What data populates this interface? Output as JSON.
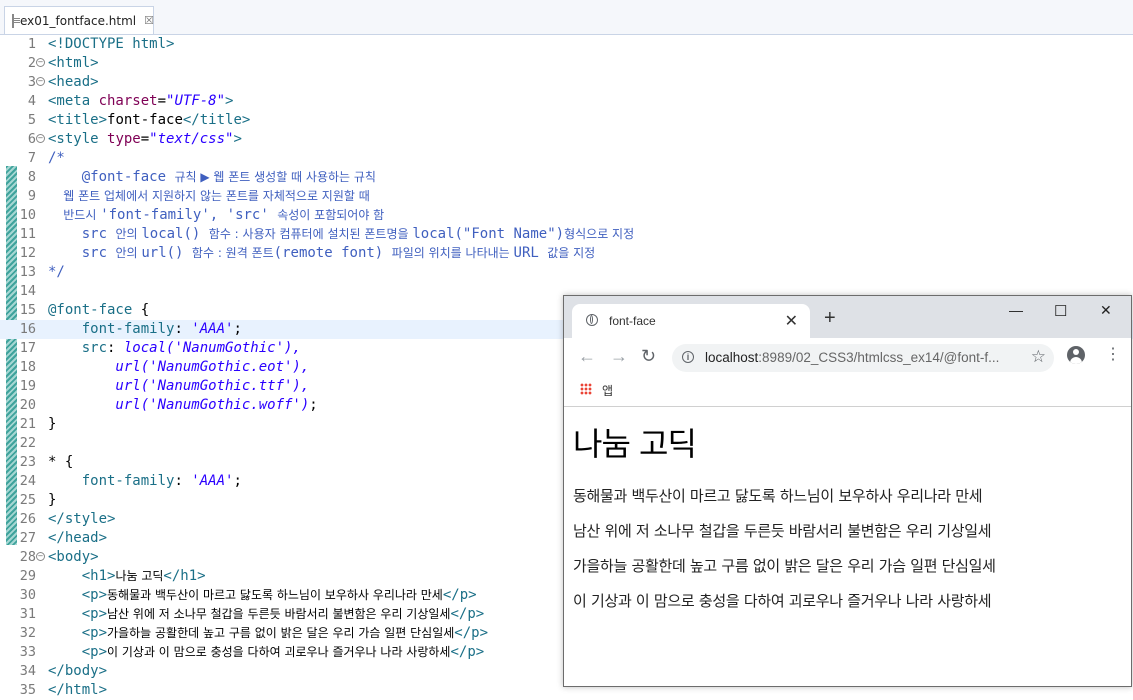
{
  "editor": {
    "tab_title": "ex01_fontface.html",
    "tab_close": "☒",
    "lines": [
      {
        "n": "1"
      },
      {
        "n": "2"
      },
      {
        "n": "3"
      },
      {
        "n": "4"
      },
      {
        "n": "5"
      },
      {
        "n": "6"
      },
      {
        "n": "7"
      },
      {
        "n": "8"
      },
      {
        "n": "9"
      },
      {
        "n": "10"
      },
      {
        "n": "11"
      },
      {
        "n": "12"
      },
      {
        "n": "13"
      },
      {
        "n": "14"
      },
      {
        "n": "15"
      },
      {
        "n": "16"
      },
      {
        "n": "17"
      },
      {
        "n": "18"
      },
      {
        "n": "19"
      },
      {
        "n": "20"
      },
      {
        "n": "21"
      },
      {
        "n": "22"
      },
      {
        "n": "23"
      },
      {
        "n": "24"
      },
      {
        "n": "25"
      },
      {
        "n": "26"
      },
      {
        "n": "27"
      },
      {
        "n": "28"
      },
      {
        "n": "29"
      },
      {
        "n": "30"
      },
      {
        "n": "31"
      },
      {
        "n": "32"
      },
      {
        "n": "33"
      },
      {
        "n": "34"
      },
      {
        "n": "35"
      }
    ],
    "code": {
      "l1": "<!DOCTYPE html>",
      "l2": "<html>",
      "l3": "<head>",
      "l4_a": "<meta ",
      "l4_b": "charset",
      "l4_c": "=",
      "l4_d": "\"UTF-8\"",
      "l4_e": ">",
      "l5_a": "<title>",
      "l5_b": "font-face",
      "l5_c": "</title>",
      "l6_a": "<style ",
      "l6_b": "type",
      "l6_c": "=",
      "l6_d": "\"text/css\"",
      "l6_e": ">",
      "l7": "/*",
      "l8_a": "    @font-face ",
      "l8_b": "규칙 ▶ 웹 폰트 생성할 때 사용하는 규칙",
      "l9": "    웹 폰트 업체에서 지원하지 않는 폰트를 자체적으로 지원할 때",
      "l10_a": "    반드시 ",
      "l10_b": "'font-family', 'src' ",
      "l10_c": "속성이 포함되어야 함",
      "l11_a": "    src ",
      "l11_b": "안의 ",
      "l11_c": "local() ",
      "l11_d": "함수 : 사용자 컴퓨터에 설치된 폰트명을 ",
      "l11_e": "local(\"Font Name\")",
      "l11_f": "형식으로 지정",
      "l12_a": "    src ",
      "l12_b": "안의 ",
      "l12_c": "url() ",
      "l12_d": "함수 : 원격 폰트",
      "l12_e": "(remote font) ",
      "l12_f": "파일의 위치를 나타내는 ",
      "l12_g": "URL ",
      "l12_h": "값을 지정",
      "l13": "*/",
      "l15_a": "@font-face",
      "l15_b": " {",
      "l16_a": "    font-family",
      "l16_b": ": ",
      "l16_c": "'AAA'",
      "l16_d": ";",
      "l17_a": "    src",
      "l17_b": ": ",
      "l17_c": "local('NanumGothic'),",
      "l18": "        url('NanumGothic.eot'),",
      "l19": "        url('NanumGothic.ttf'),",
      "l20_a": "        url('NanumGothic.woff')",
      "l20_b": ";",
      "l21": "}",
      "l23": "* {",
      "l24_a": "    font-family",
      "l24_b": ": ",
      "l24_c": "'AAA'",
      "l24_d": ";",
      "l25": "}",
      "l26": "</style>",
      "l27": "</head>",
      "l28": "<body>",
      "l29_a": "    <h1>",
      "l29_b": "나눔 고딕",
      "l29_c": "</h1>",
      "l30_a": "    <p>",
      "l30_b": "동해물과 백두산이 마르고 닳도록 하느님이 보우하사 우리나라 만세",
      "l30_c": "</p>",
      "l31_a": "    <p>",
      "l31_b": "남산 위에 저 소나무 철갑을 두른듯 바람서리 불변함은 우리 기상일세",
      "l31_c": "</p>",
      "l32_a": "    <p>",
      "l32_b": "가을하늘 공활한데 높고 구름 없이 밝은 달은 우리 가슴 일편 단심일세",
      "l32_c": "</p>",
      "l33_a": "    <p>",
      "l33_b": "이 기상과 이 맘으로 충성을 다하여 괴로우나 즐거우나 나라 사랑하세",
      "l33_c": "</p>",
      "l34": "</body>",
      "l35": "</html>"
    }
  },
  "browser": {
    "tab_title": "font-face",
    "tab_close": "✕",
    "new_tab": "+",
    "minimize": "—",
    "maximize": "☐",
    "close": "✕",
    "back": "←",
    "forward": "→",
    "reload": "↻",
    "url_host": "localhost",
    "url_rest": ":8989/02_CSS3/htmlcss_ex14/@font-f...",
    "star": "☆",
    "menu": "⋮",
    "bookmark_apps": "앱",
    "page": {
      "h1": "나눔 고딕",
      "p1": "동해물과 백두산이 마르고 닳도록 하느님이 보우하사 우리나라 만세",
      "p2": "남산 위에 저 소나무 철갑을 두른듯 바람서리 불변함은 우리 기상일세",
      "p3": "가을하늘 공활한데 높고 구름 없이 밝은 달은 우리 가슴 일편 단심일세",
      "p4": "이 기상과 이 맘으로 충성을 다하여 괴로우나 즐거우나 나라 사랑하세"
    }
  }
}
